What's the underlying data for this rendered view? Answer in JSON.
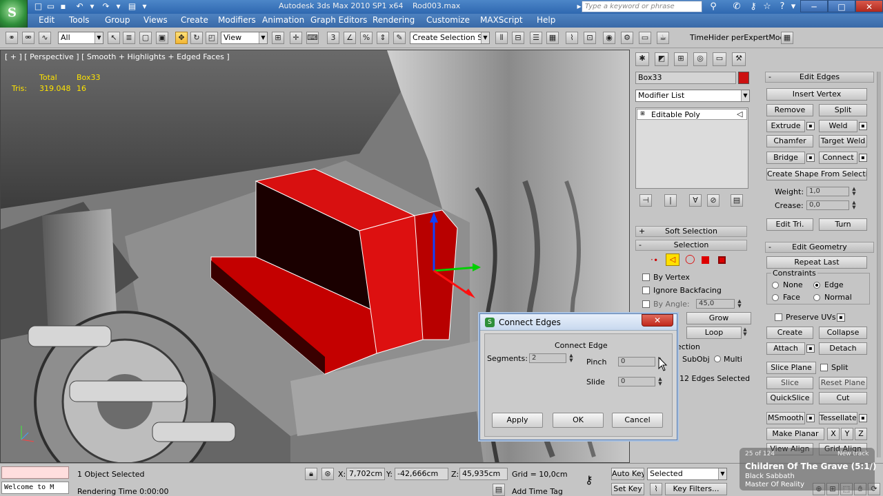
{
  "title": {
    "app": "Autodesk 3ds Max  2010 SP1 x64",
    "file": "Rod003.max",
    "search_placeholder": "Type a keyword or phrase"
  },
  "menu": [
    "Edit",
    "Tools",
    "Group",
    "Views",
    "Create",
    "Modifiers",
    "Animation",
    "Graph Editors",
    "Rendering",
    "Customize",
    "MAXScript",
    "Help"
  ],
  "toolbar": {
    "filter": "All",
    "ref_coord": "View",
    "named_selection": "Create Selection Se",
    "timehider": "TimeHider",
    "expert": "perExpertMod"
  },
  "viewport": {
    "label": "[ + ] [ Perspective ] [ Smooth + Highlights + Edged Faces ]",
    "stats_total": "Total",
    "stats_object": "Box33",
    "stats_tris_label": "Tris:",
    "stats_tris_total": "319.048",
    "stats_tris_object": "16"
  },
  "dialog": {
    "title": "Connect Edges",
    "group_title": "Connect Edge",
    "segments_label": "Segments:",
    "segments_value": "2",
    "pinch_label": "Pinch",
    "pinch_value": "0",
    "slide_label": "Slide",
    "slide_value": "0",
    "apply": "Apply",
    "ok": "OK",
    "cancel": "Cancel"
  },
  "panel": {
    "object_name": "Box33",
    "object_color": "#cc1111",
    "modifier_list": "Modifier List",
    "stack_item": "Editable Poly",
    "soft_selection": "Soft Selection",
    "selection": "Selection",
    "by_vertex": "By Vertex",
    "ignore_backfacing": "Ignore Backfacing",
    "by_angle": "By Angle:",
    "angle_value": "45,0",
    "grow": "Grow",
    "loop": "Loop",
    "ring_partial": "ection",
    "subobj": "SubObj",
    "multi": "Multi",
    "edges_selected": "12 Edges Selected"
  },
  "edit_edges": {
    "title": "Edit Edges",
    "insert_vertex": "Insert Vertex",
    "remove": "Remove",
    "split": "Split",
    "extrude": "Extrude",
    "weld": "Weld",
    "chamfer": "Chamfer",
    "target_weld": "Target Weld",
    "bridge": "Bridge",
    "connect": "Connect",
    "create_shape": "Create Shape From Selection",
    "weight_label": "Weight:",
    "weight_value": "1,0",
    "crease_label": "Crease:",
    "crease_value": "0,0",
    "edit_tri": "Edit Tri.",
    "turn": "Turn"
  },
  "edit_geometry": {
    "title": "Edit Geometry",
    "repeat_last": "Repeat Last",
    "constraints": "Constraints",
    "none": "None",
    "edge": "Edge",
    "face": "Face",
    "normal": "Normal",
    "preserve_uvs": "Preserve UVs",
    "create": "Create",
    "collapse": "Collapse",
    "attach": "Attach",
    "detach": "Detach",
    "slice_plane": "Slice Plane",
    "split": "Split",
    "slice": "Slice",
    "reset_plane": "Reset Plane",
    "quickslice": "QuickSlice",
    "cut": "Cut",
    "msmooth": "MSmooth",
    "tessellate": "Tessellate",
    "make_planar": "Make Planar",
    "x": "X",
    "y": "Y",
    "z": "Z",
    "view_align": "View Align",
    "grid_align": "Grid Align"
  },
  "status": {
    "maxscript": "Welcome to M",
    "selected": "1 Object Selected",
    "rendering_time": "Rendering Time  0:00:00",
    "x_label": "X:",
    "x_value": "7,702cm",
    "y_label": "Y:",
    "y_value": "-42,666cm",
    "z_label": "Z:",
    "z_value": "45,935cm",
    "grid": "Grid = 10,0cm",
    "add_time_tag": "Add Time Tag",
    "auto_key": "Auto Key",
    "set_key": "Set Key",
    "selected_combo": "Selected",
    "key_filters": "Key Filters..."
  },
  "watermark": {
    "counter": "25 of 124",
    "next": "New track",
    "song": "Children Of The Grave (5:1/)",
    "artist": "Black Sabbath",
    "album": "Master Of Reality"
  }
}
